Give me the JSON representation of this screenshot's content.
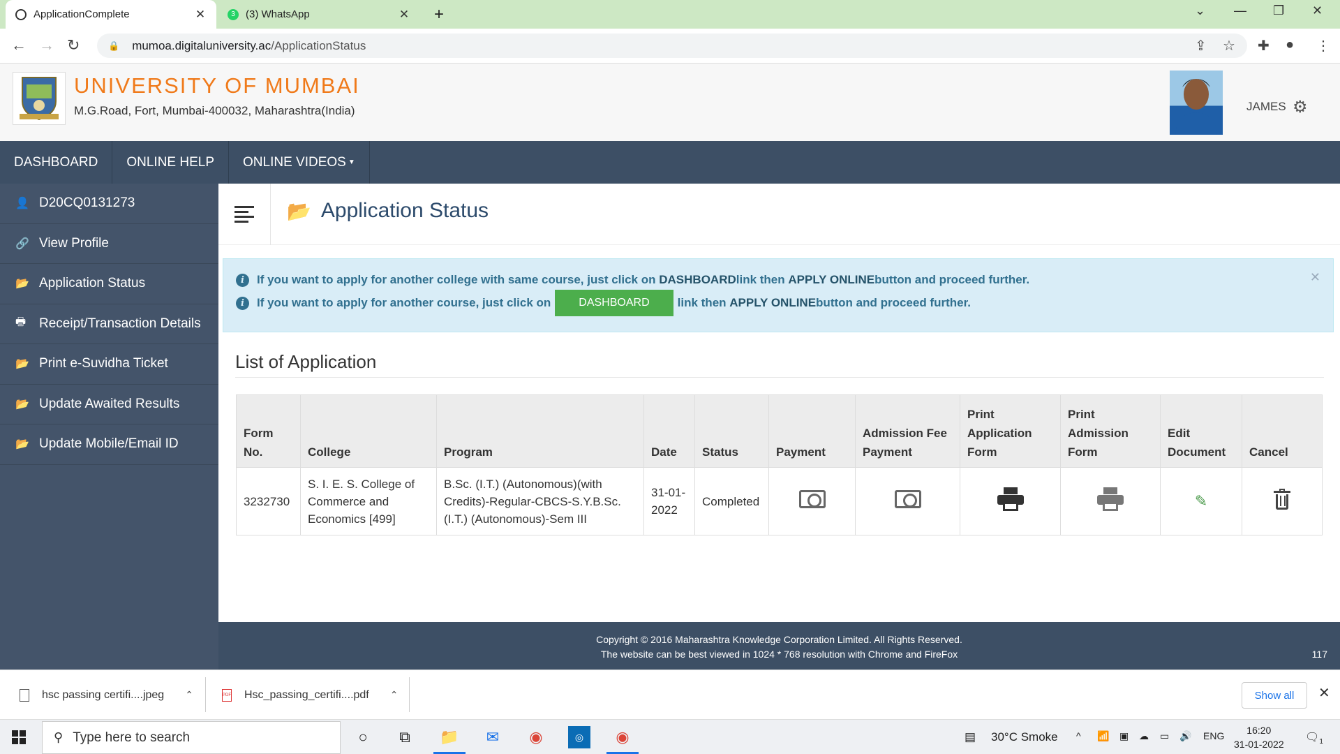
{
  "browser": {
    "tabs": [
      {
        "title": "ApplicationComplete",
        "active": true
      },
      {
        "title": "(3) WhatsApp",
        "active": false,
        "badge": "3"
      }
    ],
    "url_host": "mumoa.digitaluniversity.ac",
    "url_path": "/ApplicationStatus"
  },
  "header": {
    "university": "UNIVERSITY OF MUMBAI",
    "address": "M.G.Road, Fort, Mumbai-400032, Maharashtra(India)",
    "user": "JAMES"
  },
  "topnav": [
    "DASHBOARD",
    "ONLINE HELP",
    "ONLINE VIDEOS"
  ],
  "sidebar": {
    "items": [
      {
        "label": "D20CQ0131273",
        "icon": "user-icon"
      },
      {
        "label": "View Profile",
        "icon": "link-icon"
      },
      {
        "label": "Application Status",
        "icon": "folder-open-icon"
      },
      {
        "label": "Receipt/Transaction Details",
        "icon": "print-icon"
      },
      {
        "label": "Print e-Suvidha Ticket",
        "icon": "folder-open-icon"
      },
      {
        "label": "Update Awaited Results",
        "icon": "folder-open-icon"
      },
      {
        "label": "Update Mobile/Email ID",
        "icon": "folder-open-icon"
      }
    ]
  },
  "main": {
    "page_title": "Application Status",
    "alert": {
      "line1_prefix": "If you want to apply for another college with same course, just click on ",
      "line1_bold1": "DASHBOARD",
      "line1_mid": " link then ",
      "line1_bold2": "APPLY ONLINE",
      "line1_suffix": " button and proceed further.",
      "line2_prefix": "If you want to apply for another course, just click on",
      "dashboard_button": "DASHBOARD",
      "line2_mid": "link then ",
      "line2_bold": "APPLY ONLINE",
      "line2_suffix": " button and proceed further."
    },
    "list_title": "List of Application",
    "table": {
      "headers": {
        "form_no": [
          "Form",
          "No."
        ],
        "college": "College",
        "program": "Program",
        "date": "Date",
        "status": "Status",
        "payment": "Payment",
        "admission_fee": [
          "Admission Fee",
          "Payment"
        ],
        "print_application": [
          "Print",
          "Application",
          "Form"
        ],
        "print_admission": [
          "Print",
          "Admission",
          "Form"
        ],
        "edit_document": [
          "Edit",
          "Document"
        ],
        "cancel": "Cancel"
      },
      "rows": [
        {
          "form_no": "3232730",
          "college": [
            "S. I. E. S. College of",
            "Commerce and",
            "Economics [499]"
          ],
          "program": [
            "B.Sc. (I.T.) (Autonomous)(with",
            "Credits)-Regular-CBCS-S.Y.B.Sc.",
            "(I.T.) (Autonomous)-Sem III"
          ],
          "date": [
            "31-01-",
            "2022"
          ],
          "status": "Completed"
        }
      ]
    }
  },
  "footer": {
    "copyright": "Copyright © 2016 Maharashtra Knowledge Corporation Limited. All Rights Reserved.",
    "best_viewed": "The website can be best viewed in 1024 * 768 resolution with Chrome and FireFox",
    "count": "117"
  },
  "downloads": {
    "items": [
      "hsc passing certifi....jpeg",
      "Hsc_passing_certifi....pdf"
    ],
    "show_all": "Show all"
  },
  "taskbar": {
    "search_placeholder": "Type here to search",
    "weather": "30°C  Smoke",
    "lang": "ENG",
    "time": "16:20",
    "date": "31-01-2022",
    "notif_count": "1"
  },
  "colors": {
    "brand_orange": "#f07a1a",
    "nav_bg": "#3d4f65",
    "sidebar_bg": "#44546a",
    "alert_bg": "#d9edf7",
    "button_green": "#4cae4c"
  }
}
